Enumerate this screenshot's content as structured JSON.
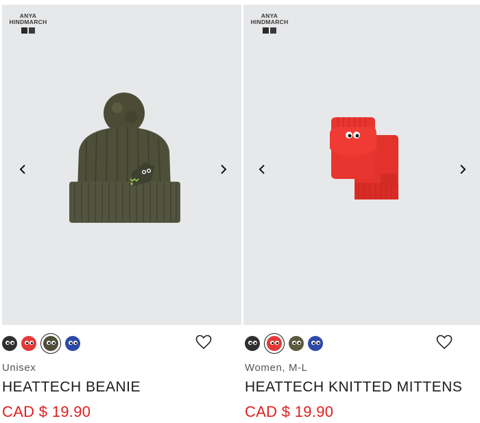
{
  "products": [
    {
      "brand": {
        "line1": "ANYA",
        "line2": "HINDMARCH"
      },
      "category": "Unisex",
      "name": "HEATTECH BEANIE",
      "price": "CAD $ 19.90",
      "colors": [
        {
          "name": "dark gray",
          "hex": "#2f2f31",
          "selected": false
        },
        {
          "name": "red",
          "hex": "#e23a36",
          "selected": false
        },
        {
          "name": "olive",
          "hex": "#4f4f39",
          "selected": true
        },
        {
          "name": "blue",
          "hex": "#2c49a8",
          "selected": false
        }
      ],
      "image_icon": "olive-knit-beanie-image"
    },
    {
      "brand": {
        "line1": "ANYA",
        "line2": "HINDMARCH"
      },
      "category": "Women, M-L",
      "name": "HEATTECH KNITTED MITTENS",
      "price": "CAD $ 19.90",
      "colors": [
        {
          "name": "dark gray",
          "hex": "#2f2f31",
          "selected": false
        },
        {
          "name": "red",
          "hex": "#e23a36",
          "selected": true
        },
        {
          "name": "olive",
          "hex": "#5a5a3c",
          "selected": false
        },
        {
          "name": "blue",
          "hex": "#2c49a8",
          "selected": false
        }
      ],
      "image_icon": "red-knitted-mittens-image"
    }
  ],
  "icons": {
    "prev": "chevron-left-icon",
    "next": "chevron-right-icon",
    "favorite": "heart-outline-icon"
  },
  "colors": {
    "price": "#e01e1e",
    "image_bg": "#e7e8ea"
  }
}
